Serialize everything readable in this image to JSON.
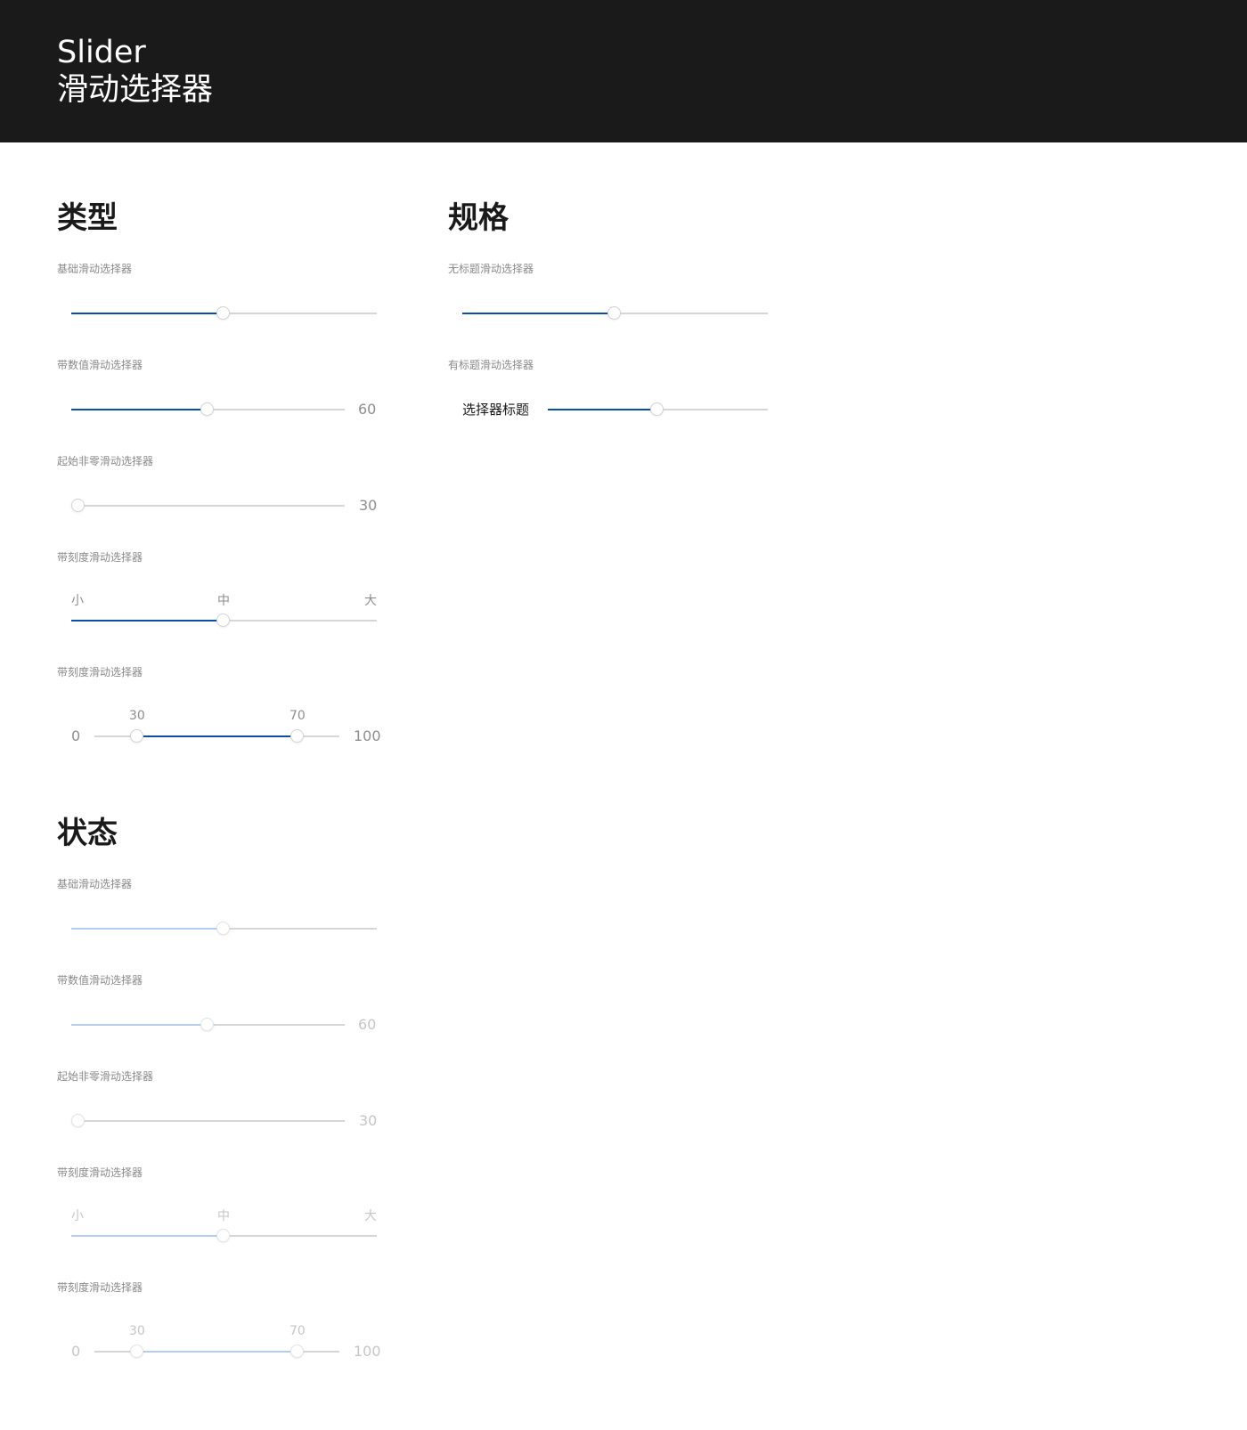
{
  "header": {
    "title_en": "Slider",
    "title_cn": "滑动选择器"
  },
  "colors": {
    "header_bg": "#1a1a1a",
    "accent": "#0b4ea2",
    "accent_disabled": "#b5cdef",
    "track": "#d6d6d6"
  },
  "types": {
    "title": "类型",
    "basic": {
      "label": "基础滑动选择器",
      "value": 0.5
    },
    "with_value": {
      "label": "带数值滑动选择器",
      "value_text": "60"
    },
    "nonzero": {
      "label": "起始非零滑动选择器",
      "value_text": "30"
    },
    "ticks": {
      "label": "带刻度滑动选择器",
      "small": "小",
      "middle": "中",
      "large": "大"
    },
    "range": {
      "label": "带刻度滑动选择器",
      "min": "0",
      "max": "100",
      "low": "30",
      "high": "70"
    }
  },
  "specs": {
    "title": "规格",
    "no_title": {
      "label": "无标题滑动选择器"
    },
    "with_title": {
      "label": "有标题滑动选择器",
      "slider_title": "选择器标题"
    }
  },
  "states": {
    "title": "状态",
    "basic": {
      "label": "基础滑动选择器"
    },
    "with_value": {
      "label": "带数值滑动选择器",
      "value_text": "60"
    },
    "nonzero": {
      "label": "起始非零滑动选择器",
      "value_text": "30"
    },
    "ticks": {
      "label": "带刻度滑动选择器",
      "small": "小",
      "middle": "中",
      "large": "大"
    },
    "range": {
      "label": "带刻度滑动选择器",
      "min": "0",
      "max": "100",
      "low": "30",
      "high": "70"
    }
  }
}
